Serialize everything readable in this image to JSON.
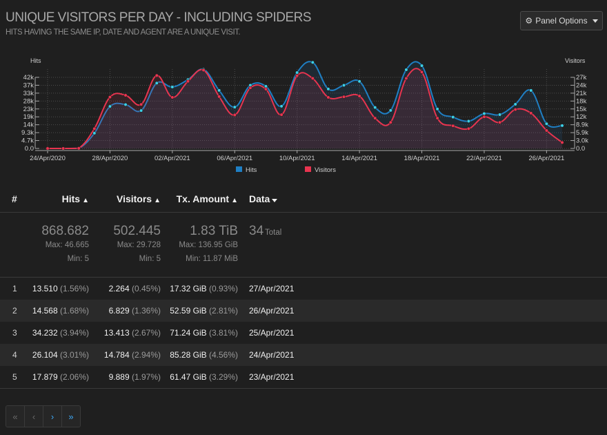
{
  "header": {
    "title": "UNIQUE VISITORS PER DAY - INCLUDING SPIDERS",
    "subtitle": "HITS HAVING THE SAME IP, DATE AND AGENT ARE A UNIQUE VISIT.",
    "panel_options_label": "Panel Options",
    "panel_options_icon": "gear-icon"
  },
  "chart_data": {
    "type": "line",
    "left_axis_title": "Hits",
    "right_axis_title": "Visitors",
    "left_ticks": [
      "0.0",
      "4.7k",
      "9.3k",
      "14k",
      "19k",
      "23k",
      "28k",
      "33k",
      "37k",
      "42k"
    ],
    "right_ticks": [
      "0.0",
      "3.0k",
      "5.9k",
      "8.9k",
      "12k",
      "15k",
      "18k",
      "21k",
      "24k",
      "27k"
    ],
    "x_tick_labels": [
      "24/Apr/2020",
      "28/Apr/2020",
      "02/Apr/2021",
      "06/Apr/2021",
      "10/Apr/2021",
      "14/Apr/2021",
      "18/Apr/2021",
      "22/Apr/2021",
      "26/Apr/2021"
    ],
    "x": [
      "24/Apr/2020",
      "25/Apr/2020",
      "26/Apr/2020",
      "27/Apr/2020",
      "28/Apr/2020",
      "29/Apr/2020",
      "30/Apr/2020",
      "01/Apr/2021",
      "02/Apr/2021",
      "03/Apr/2021",
      "04/Apr/2021",
      "05/Apr/2021",
      "06/Apr/2021",
      "07/Apr/2021",
      "08/Apr/2021",
      "09/Apr/2021",
      "10/Apr/2021",
      "11/Apr/2021",
      "12/Apr/2021",
      "13/Apr/2021",
      "14/Apr/2021",
      "15/Apr/2021",
      "16/Apr/2021",
      "17/Apr/2021",
      "18/Apr/2021",
      "19/Apr/2021",
      "20/Apr/2021",
      "21/Apr/2021",
      "22/Apr/2021",
      "23/Apr/2021",
      "24/Apr/2021",
      "25/Apr/2021",
      "26/Apr/2021",
      "27/Apr/2021"
    ],
    "series": [
      {
        "name": "Hits",
        "color": "#1f7fc4",
        "point_color": "#3ccfe6",
        "axis": "left",
        "values": [
          5,
          5,
          120,
          9000,
          24800,
          25900,
          22400,
          38600,
          36300,
          40600,
          46665,
          34300,
          24400,
          37300,
          36700,
          24900,
          44800,
          50800,
          35100,
          37300,
          39600,
          24200,
          22500,
          46500,
          48900,
          23300,
          18500,
          16100,
          20600,
          20000,
          26104,
          34232,
          14568,
          13510
        ]
      },
      {
        "name": "Visitors",
        "color": "#e8344f",
        "point_color": "#e8344f",
        "axis": "right",
        "values": [
          5,
          5,
          80,
          7500,
          19500,
          20200,
          16700,
          27700,
          19400,
          25500,
          29728,
          19700,
          12700,
          23000,
          22500,
          12800,
          27600,
          26600,
          19400,
          19600,
          19900,
          11500,
          9900,
          26600,
          29000,
          11500,
          8600,
          7500,
          12000,
          9889,
          14784,
          13413,
          6829,
          2264
        ]
      }
    ],
    "legend": "bottom",
    "grid": true
  },
  "table": {
    "headers": {
      "index": "#",
      "hits": "Hits",
      "visitors": "Visitors",
      "tx": "Tx. Amount",
      "data": "Data"
    },
    "summary": {
      "hits_total": "868.682",
      "hits_max": "Max: 46.665",
      "hits_min": "Min: 5",
      "visitors_total": "502.445",
      "visitors_max": "Max: 29.728",
      "visitors_min": "Min: 5",
      "tx_total": "1.83 TiB",
      "tx_max": "Max: 136.95 GiB",
      "tx_min": "Min: 11.87 MiB",
      "data_count": "34",
      "data_label": "Total"
    },
    "rows": [
      {
        "idx": "1",
        "hits": "13.510",
        "hits_pct": "(1.56%)",
        "visitors": "2.264",
        "visitors_pct": "(0.45%)",
        "tx": "17.32 GiB",
        "tx_pct": "(0.93%)",
        "date": "27/Apr/2021"
      },
      {
        "idx": "2",
        "hits": "14.568",
        "hits_pct": "(1.68%)",
        "visitors": "6.829",
        "visitors_pct": "(1.36%)",
        "tx": "52.59 GiB",
        "tx_pct": "(2.81%)",
        "date": "26/Apr/2021"
      },
      {
        "idx": "3",
        "hits": "34.232",
        "hits_pct": "(3.94%)",
        "visitors": "13.413",
        "visitors_pct": "(2.67%)",
        "tx": "71.24 GiB",
        "tx_pct": "(3.81%)",
        "date": "25/Apr/2021"
      },
      {
        "idx": "4",
        "hits": "26.104",
        "hits_pct": "(3.01%)",
        "visitors": "14.784",
        "visitors_pct": "(2.94%)",
        "tx": "85.28 GiB",
        "tx_pct": "(4.56%)",
        "date": "24/Apr/2021"
      },
      {
        "idx": "5",
        "hits": "17.879",
        "hits_pct": "(2.06%)",
        "visitors": "9.889",
        "visitors_pct": "(1.97%)",
        "tx": "61.47 GiB",
        "tx_pct": "(3.29%)",
        "date": "23/Apr/2021"
      }
    ]
  },
  "pagination": {
    "first": "«",
    "prev": "‹",
    "next": "›",
    "last": "»"
  }
}
